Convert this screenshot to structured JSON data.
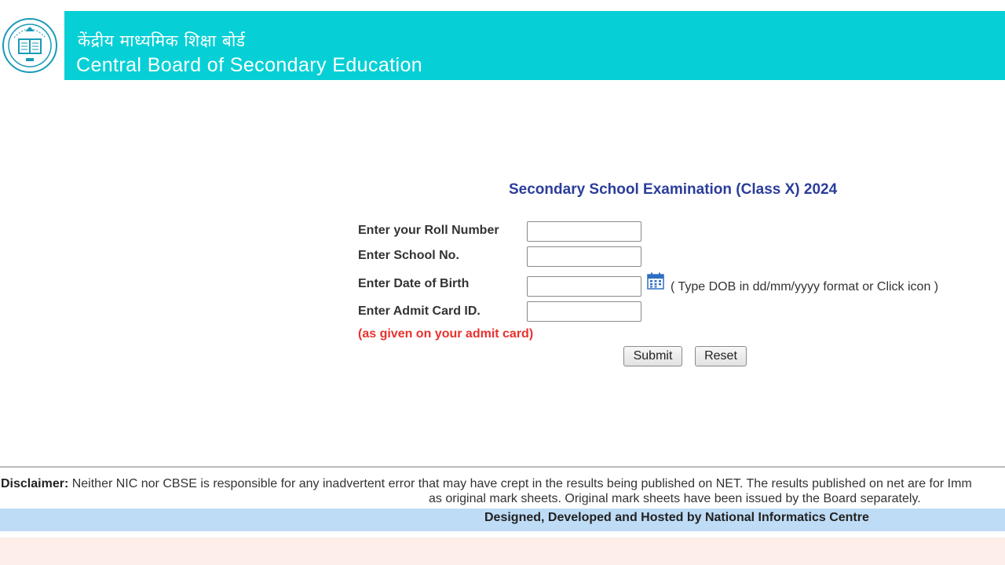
{
  "header": {
    "title_hindi": "केंद्रीय माध्यमिक शिक्षा बोर्ड",
    "title_english": "Central Board of Secondary Education",
    "logo_icon": "cbse-emblem-icon",
    "banner_color": "#06d0d6"
  },
  "form": {
    "title": "Secondary School Examination (Class X) 2024",
    "fields": [
      {
        "label": "Enter your Roll Number",
        "value": ""
      },
      {
        "label": "Enter School No.",
        "value": ""
      },
      {
        "label": "Enter Date of Birth",
        "value": ""
      },
      {
        "label": "Enter Admit Card ID.",
        "value": ""
      }
    ],
    "dob_hint": "( Type DOB in dd/mm/yyyy format or Click icon )",
    "calendar_icon": "calendar-icon",
    "admit_card_note": "(as given on your admit card)",
    "submit_label": "Submit",
    "reset_label": "Reset"
  },
  "footer": {
    "disclaimer_label": "Disclaimer:",
    "disclaimer_text": "Neither NIC nor CBSE is responsible for any inadvertent error that may have crept in the results being published on NET. The results published on net are for Imm",
    "disclaimer_text_2": "as original mark sheets. Original mark sheets have been issued by the Board separately.",
    "credit": "Designed, Developed and Hosted by National Informatics Centre"
  }
}
